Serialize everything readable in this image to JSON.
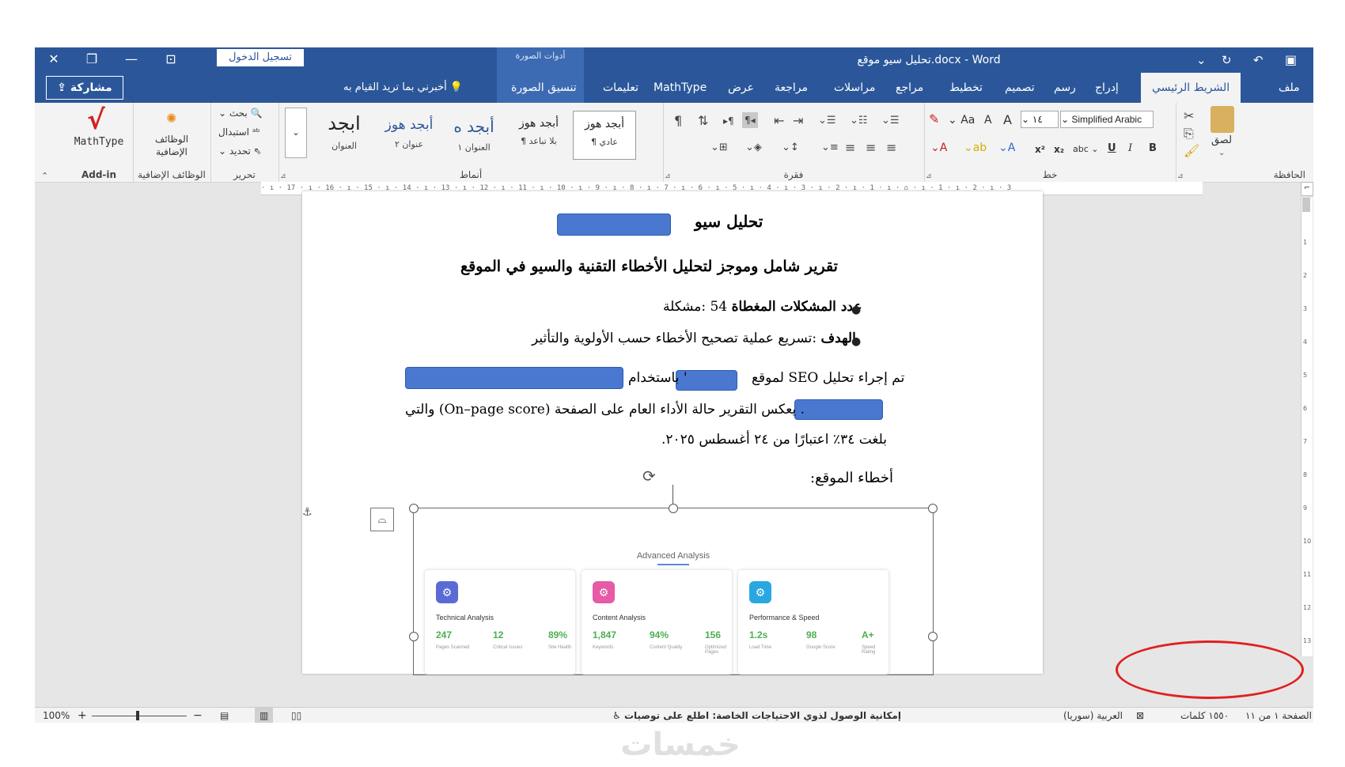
{
  "window": {
    "title": "تحليل سيو موقع.docx - Word",
    "signin_label": "تسجيل الدخول",
    "context_group": "أدوات الصورة",
    "controls": {
      "close": "✕",
      "restore": "❐",
      "minimize": "—",
      "ribbon_display": "⊡"
    },
    "quick_access": {
      "customize": "⌄",
      "repeat": "↻",
      "undo": "↶",
      "save": "💾"
    }
  },
  "ribbon_tabs": {
    "file": "ملف",
    "home": "الشريط الرئيسي",
    "insert": "إدراج",
    "draw": "رسم",
    "design": "تصميم",
    "layout": "تخطيط",
    "references": "مراجع",
    "mailings": "مراسلات",
    "review": "مراجعة",
    "view": "عرض",
    "mathtype": "MathType",
    "help": "تعليمات",
    "picture_format": "تنسيق الصورة",
    "tell_me": "أخبرني بما تريد القيام به",
    "share": "مشاركة"
  },
  "ribbon": {
    "clipboard": {
      "label": "الحافظة",
      "paste": "لصق"
    },
    "font": {
      "label": "خط",
      "font_name": "Simplified Arabic",
      "font_size": "١٤",
      "bold": "B",
      "italic": "I",
      "underline": "U",
      "strike": "abc",
      "subscript": "x₂",
      "superscript": "x²",
      "grow": "A",
      "shrink": "A",
      "case": "Aa"
    },
    "paragraph": {
      "label": "فقرة"
    },
    "styles": {
      "label": "أنماط",
      "items": [
        {
          "preview": "أبجد هوز",
          "name": "¶ عادي"
        },
        {
          "preview": "أبجد هوز",
          "name": "¶ بلا تباعد"
        },
        {
          "preview": "أبجد ه",
          "name": "العنوان ١"
        },
        {
          "preview": "أبجد هوز",
          "name": "عنوان ٢"
        },
        {
          "preview": "ابجد",
          "name": "العنوان"
        }
      ]
    },
    "editing": {
      "label": "تحرير",
      "find": "بحث",
      "replace": "استبدال",
      "select": "تحديد"
    },
    "addins": {
      "label": "الوظائف الإضافية",
      "button": "الوظائف الإضافية"
    },
    "addin": {
      "label": "Add-in",
      "mathtype": "MathType"
    }
  },
  "ruler": {
    "h_marks": "· ı · 17 · ı · 16 · ı · 15 · ı · 14 · ı · 13 · ı · 12 · ı · 11 · ı · 10 · ı · 9 · ı · 8 · ı · 7 · ı · 6 · ı · 5 · ı · 4 · ı · 3 · ı · 2 · ı · 1 · ı · ⌂ · ı · 1 · ı · 2 · ı · 3"
  },
  "document": {
    "title": "تحليل سيو",
    "subtitle": "تقرير شامل وموجز لتحليل الأخطاء التقنية والسيو في الموقع",
    "bullet1_bold": "عدد المشكلات المغطاة",
    "bullet1_rest": "54 :مشكلة",
    "bullet2_bold": "الهدف",
    "bullet2_rest": ":تسريع عملية تصحيح الأخطاء حسب الأولوية والتأثير",
    "para_line1_a": "تم إجراء تحليل SEO لموقع",
    "para_line1_b": "' باستخدام",
    "para_line2": ". يعكس التقرير حالة الأداء العام على الصفحة (On–page score) والتي",
    "para_line3": "بلغت ٣٤٪ اعتبارًا من ٢٤ أغسطس ٢٠٢٥.",
    "errors_heading": "أخطاء الموقع:"
  },
  "image": {
    "heading": "Advanced Analysis",
    "cards": [
      {
        "title": "Technical Analysis",
        "color": "#5b6bd6",
        "stats": [
          {
            "value": "247",
            "label": "Pages Scanned"
          },
          {
            "value": "12",
            "label": "Critical Issues"
          },
          {
            "value": "89%",
            "label": "Site Health"
          }
        ]
      },
      {
        "title": "Content Analysis",
        "color": "#e65aa6",
        "stats": [
          {
            "value": "1,847",
            "label": "Keywords"
          },
          {
            "value": "94%",
            "label": "Content Quality"
          },
          {
            "value": "156",
            "label": "Optimized Pages"
          }
        ]
      },
      {
        "title": "Performance & Speed",
        "color": "#2aa7e0",
        "stats": [
          {
            "value": "1.2s",
            "label": "Load Time"
          },
          {
            "value": "98",
            "label": "Google Score"
          },
          {
            "value": "A+",
            "label": "Speed Rating"
          }
        ]
      }
    ]
  },
  "statusbar": {
    "page": "الصفحة ١ من ١١",
    "words": "١٥٥٠ كلمات",
    "language": "العربية (سوريا)",
    "accessibility": "إمكانية الوصول لذوي الاحتياجات الخاصة: اطلع على توصيات",
    "zoom": "100%"
  },
  "watermark": "خمسات"
}
